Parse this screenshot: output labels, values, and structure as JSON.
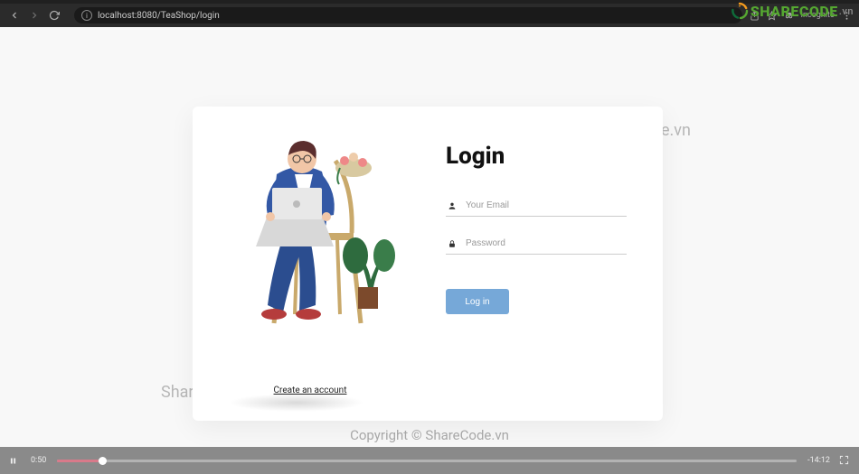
{
  "browser": {
    "url": "localhost:8080/TeaShop/login",
    "incognito_label": "Incognito"
  },
  "watermarks": {
    "top": "ShareCode.vn",
    "bottom": "ShareCode.vn",
    "copyright": "Copyright © ShareCode.vn",
    "logo_main": "SHARECODE",
    "logo_suffix": ".vn"
  },
  "login": {
    "title": "Login",
    "email_placeholder": "Your Email",
    "password_placeholder": "Password",
    "button_label": "Log in",
    "create_account": "Create an account"
  },
  "player": {
    "current": "0:50",
    "remaining": "-14:12"
  }
}
